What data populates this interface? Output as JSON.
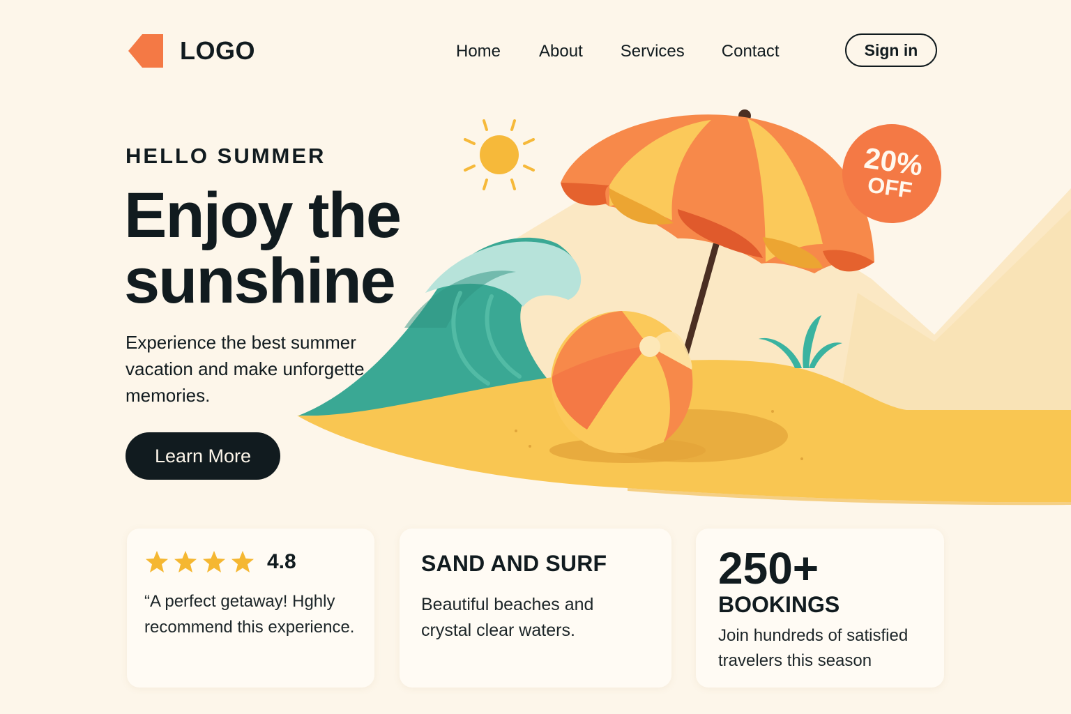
{
  "header": {
    "logo_text": "LOGO",
    "nav": [
      "Home",
      "About",
      "Services",
      "Contact"
    ],
    "signin_label": "Sign in"
  },
  "hero": {
    "eyebrow": "HELLO SUMMER",
    "headline_line1": "Enjoy the",
    "headline_line2": "sunshine",
    "subtext_line1": "Experience the best summer",
    "subtext_line2": "vacation and make unforgette",
    "subtext_line3": "memories.",
    "cta_label": "Learn More",
    "badge_pct": "20%",
    "badge_off": "OFF"
  },
  "cards": {
    "rating": {
      "stars": 4,
      "value": "4.8",
      "quote_line1": "“A perfect getaway! Hghly",
      "quote_line2": "recommend this experience."
    },
    "surf": {
      "title": "SAND AND SURF",
      "text_line1": "Beautiful beaches and",
      "text_line2": "crystal clear waters."
    },
    "bookings": {
      "number": "250+",
      "label": "BOOKINGS",
      "text_line1": "Join hundreds of satisfied",
      "text_line2": "travelers this season"
    }
  },
  "colors": {
    "background": "#fdf6ea",
    "accent_orange": "#f47945",
    "sand": "#f9c652",
    "wave": "#3aa894",
    "dark": "#111b1f",
    "star": "#f5b731"
  },
  "icons": {
    "logo": "logo-tag-icon",
    "star": "star-icon",
    "sun": "sun-icon"
  }
}
